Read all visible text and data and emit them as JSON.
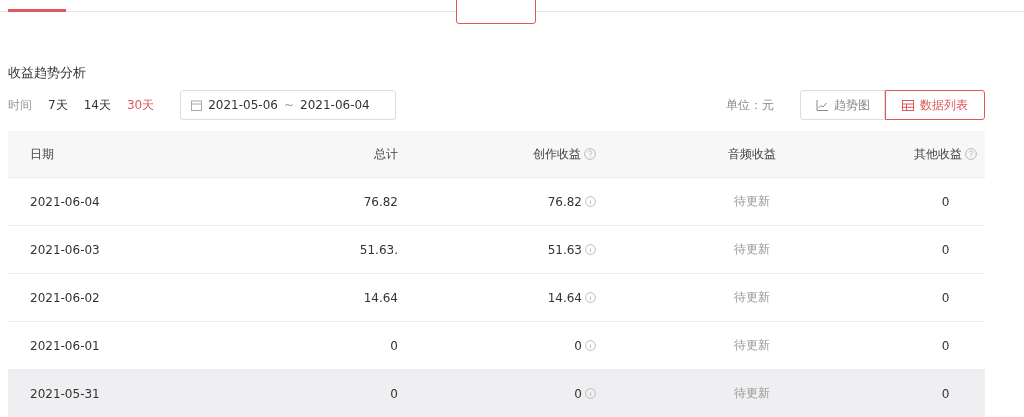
{
  "section_title": "收益趋势分析",
  "filter": {
    "label": "时间",
    "ranges": [
      {
        "label": "7天",
        "selected": false
      },
      {
        "label": "14天",
        "selected": false
      },
      {
        "label": "30天",
        "selected": true
      }
    ],
    "date_range": {
      "start": "2021-05-06",
      "separator": "~",
      "end": "2021-06-04"
    }
  },
  "unit": "单位：元",
  "views": [
    {
      "label": "趋势图",
      "selected": false
    },
    {
      "label": "数据列表",
      "selected": true
    }
  ],
  "table": {
    "columns": [
      {
        "label": "日期",
        "help": false
      },
      {
        "label": "总计",
        "help": false
      },
      {
        "label": "创作收益",
        "help": true
      },
      {
        "label": "音频收益",
        "help": false
      },
      {
        "label": "其他收益",
        "help": true
      }
    ],
    "rows": [
      {
        "date": "2021-06-04",
        "total": "76.82",
        "creation": "76.82",
        "audio": "待更新",
        "other": "0",
        "hovered": false
      },
      {
        "date": "2021-06-03",
        "total": "51.63.",
        "creation": "51.63",
        "audio": "待更新",
        "other": "0",
        "hovered": false
      },
      {
        "date": "2021-06-02",
        "total": "14.64",
        "creation": "14.64",
        "audio": "待更新",
        "other": "0",
        "hovered": false
      },
      {
        "date": "2021-06-01",
        "total": "0",
        "creation": "0",
        "audio": "待更新",
        "other": "0",
        "hovered": false
      },
      {
        "date": "2021-05-31",
        "total": "0",
        "creation": "0",
        "audio": "待更新",
        "other": "0",
        "hovered": true
      }
    ]
  }
}
